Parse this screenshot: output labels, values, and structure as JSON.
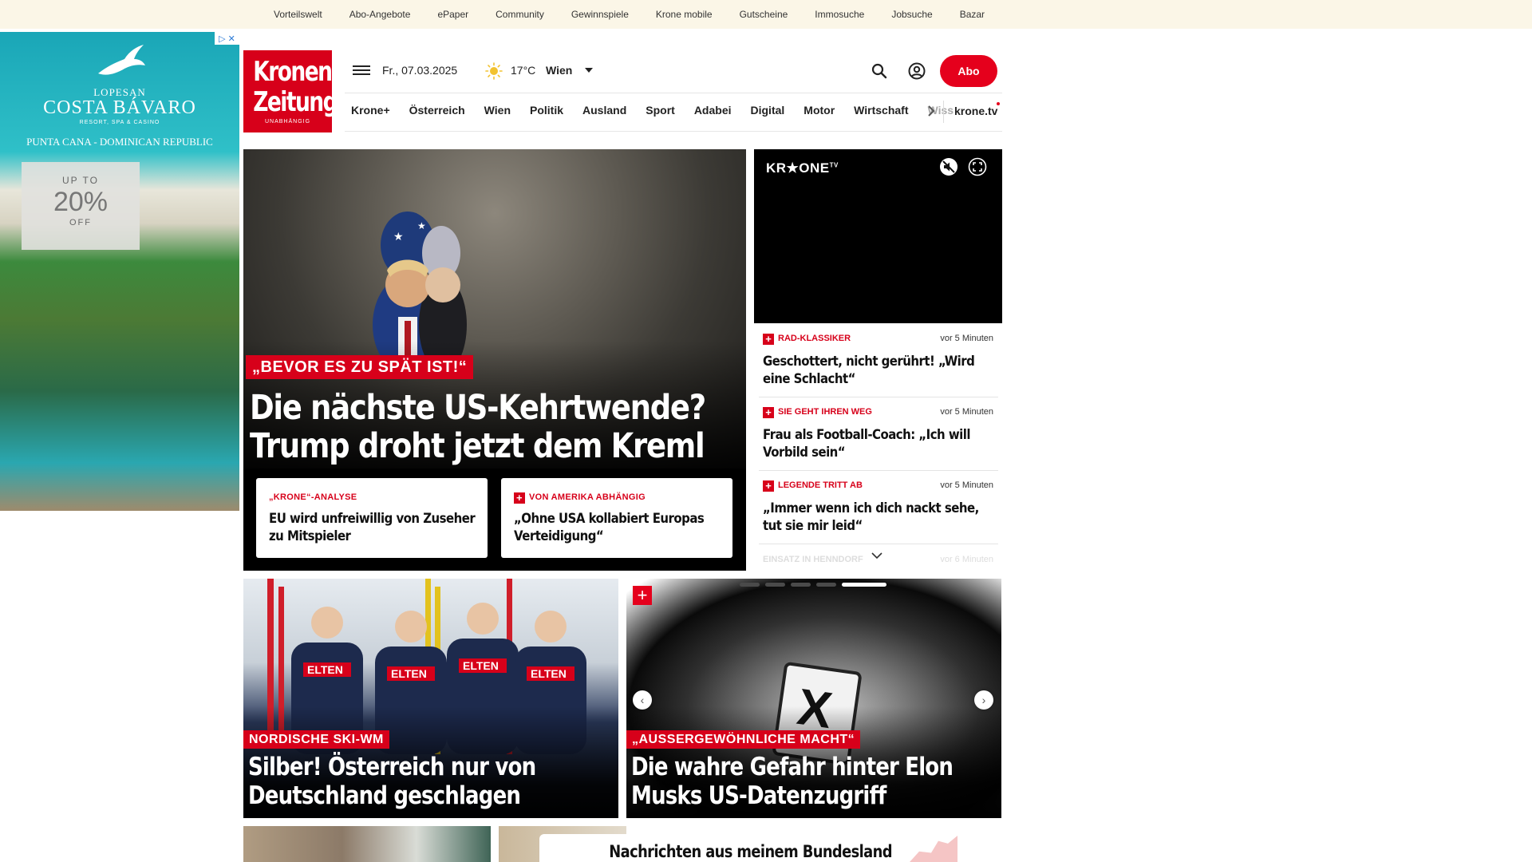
{
  "topbar": {
    "links": [
      "Vorteilswelt",
      "Abo-Angebote",
      "ePaper",
      "Community",
      "Gewinnspiele",
      "Krone mobile",
      "Gutscheine",
      "Immosuche",
      "Jobsuche",
      "Bazar"
    ]
  },
  "ad": {
    "brand_top": "LOPESAN",
    "brand_main": "COSTA BÁVARO",
    "brand_sub": "RESORT, SPA & CASINO",
    "location": "PUNTA CANA - DOMINICAN REPUBLIC",
    "offer_upto": "UP TO",
    "offer_percent": "20%",
    "offer_off": "OFF"
  },
  "header": {
    "logo_line1": "Kronen",
    "logo_line2": "Zeitung",
    "logo_tagline": "UNABHÄNGIG",
    "date": "Fr., 07.03.2025",
    "weather_icon": "sun-icon",
    "temperature": "17°C",
    "city": "Wien",
    "abo_label": "Abo"
  },
  "nav": {
    "items": [
      "Krone+",
      "Österreich",
      "Wien",
      "Politik",
      "Ausland",
      "Sport",
      "Adabei",
      "Digital",
      "Motor",
      "Wirtschaft",
      "Wiss"
    ],
    "tv_label": "krone.tv"
  },
  "hero": {
    "kicker": "„BEVOR ES ZU SPÄT IST!“",
    "headline": "Die nächste US-Kehrtwende? Trump droht jetzt dem Kreml",
    "subcards": [
      {
        "kicker": "„KRONE“-ANALYSE",
        "title": "EU wird unfreiwillig von Zuseher zu Mitspieler",
        "plus": false
      },
      {
        "kicker": "VON AMERIKA ABHÄNGIG",
        "title": "„Ohne USA kollabiert Europas Verteidigung“",
        "plus": true
      }
    ]
  },
  "video": {
    "brand": "KR★ONE",
    "brand_sup": "TV"
  },
  "ticker": {
    "items": [
      {
        "kicker": "RAD-KLASSIKER",
        "time": "vor 5 Minuten",
        "title": "Geschottert, nicht gerührt! „Wird eine Schlacht“"
      },
      {
        "kicker": "SIE GEHT IHREN WEG",
        "time": "vor 5 Minuten",
        "title": "Frau als Football-Coach: „Ich will Vorbild sein“"
      },
      {
        "kicker": "LEGENDE TRITT AB",
        "time": "vor 5 Minuten",
        "title": "„Immer wenn ich dich nackt sehe, tut sie mir leid“"
      }
    ],
    "faded": {
      "kicker": "EINSATZ IN HENNDORF",
      "time": "vor 6 Minuten"
    }
  },
  "cards": [
    {
      "kicker": "NORDISCHE SKI-WM",
      "headline": "Silber! Österreich nur von Deutschland geschlagen"
    },
    {
      "kicker": "„AUSSERGEWÖHNLICHE MACHT“",
      "headline": "Die wahre Gefahr hinter Elon Musks US-Datenzugriff"
    }
  ],
  "slider": {
    "count": 5,
    "active": 5
  },
  "bundesland": {
    "title": "Nachrichten aus meinem Bundesland"
  },
  "colors": {
    "accent": "#d7001a",
    "abo": "#e5001c",
    "topbar_bg": "#fbf6e7"
  }
}
